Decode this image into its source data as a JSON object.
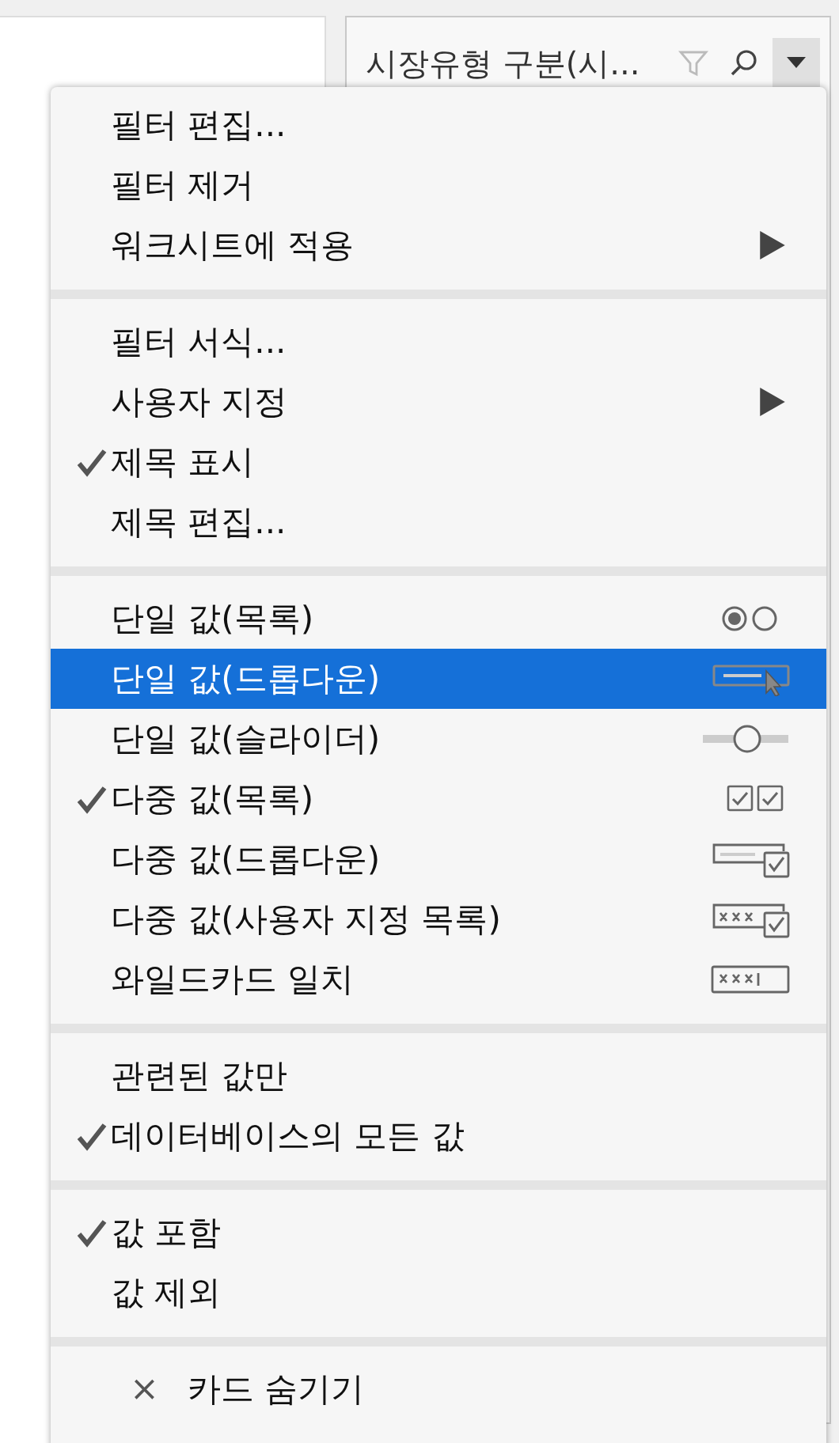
{
  "card": {
    "title": "시장유형 구분(시..."
  },
  "menu": {
    "sections": [
      {
        "items": [
          {
            "label": "필터 편집...",
            "kind": "plain",
            "checked": false,
            "selected": false,
            "submenu": false
          },
          {
            "label": "필터 제거",
            "kind": "plain",
            "checked": false,
            "selected": false,
            "submenu": false
          },
          {
            "label": "워크시트에 적용",
            "kind": "plain",
            "checked": false,
            "selected": false,
            "submenu": true
          }
        ]
      },
      {
        "items": [
          {
            "label": "필터 서식...",
            "kind": "plain",
            "checked": false,
            "selected": false,
            "submenu": false
          },
          {
            "label": "사용자 지정",
            "kind": "plain",
            "checked": false,
            "selected": false,
            "submenu": true
          },
          {
            "label": "제목 표시",
            "kind": "plain",
            "checked": true,
            "selected": false,
            "submenu": false
          },
          {
            "label": "제목 편집...",
            "kind": "plain",
            "checked": false,
            "selected": false,
            "submenu": false
          }
        ]
      },
      {
        "items": [
          {
            "label": "단일 값(목록)",
            "kind": "radio-list",
            "checked": false,
            "selected": false,
            "submenu": false
          },
          {
            "label": "단일 값(드롭다운)",
            "kind": "dropdown",
            "checked": false,
            "selected": true,
            "submenu": false
          },
          {
            "label": "단일 값(슬라이더)",
            "kind": "slider",
            "checked": false,
            "selected": false,
            "submenu": false
          },
          {
            "label": "다중 값(목록)",
            "kind": "checkbox-list",
            "checked": true,
            "selected": false,
            "submenu": false
          },
          {
            "label": "다중 값(드롭다운)",
            "kind": "multi-dropdown",
            "checked": false,
            "selected": false,
            "submenu": false
          },
          {
            "label": "다중 값(사용자 지정 목록)",
            "kind": "custom-list",
            "checked": false,
            "selected": false,
            "submenu": false
          },
          {
            "label": "와일드카드 일치",
            "kind": "wildcard",
            "checked": false,
            "selected": false,
            "submenu": false
          }
        ]
      },
      {
        "items": [
          {
            "label": "관련된 값만",
            "kind": "plain",
            "checked": false,
            "selected": false,
            "submenu": false
          },
          {
            "label": "데이터베이스의 모든 값",
            "kind": "plain",
            "checked": true,
            "selected": false,
            "submenu": false
          }
        ]
      },
      {
        "items": [
          {
            "label": "값 포함",
            "kind": "plain",
            "checked": true,
            "selected": false,
            "submenu": false
          },
          {
            "label": "값 제외",
            "kind": "plain",
            "checked": false,
            "selected": false,
            "submenu": false
          }
        ]
      },
      {
        "items": [
          {
            "label": "카드 숨기기",
            "kind": "hide",
            "icon": "×",
            "checked": false,
            "selected": false,
            "submenu": false
          }
        ]
      }
    ]
  }
}
